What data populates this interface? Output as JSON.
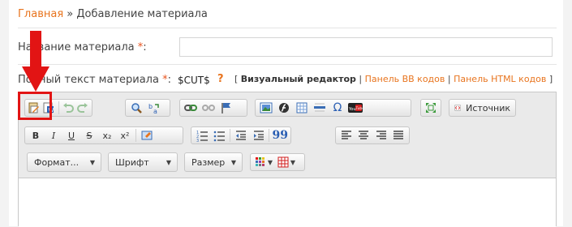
{
  "breadcrumb": {
    "home": "Главная",
    "separator": " » ",
    "current": "Добавление материала"
  },
  "form": {
    "title_label": "Название материала",
    "required_mark": "*",
    "title_suffix": ":",
    "fulltext_label": "Полный текст материала",
    "fulltext_suffix": ":",
    "cut_tag": "$CUT$",
    "help_mark": "?"
  },
  "modes": {
    "open_bracket": "[",
    "visual": "Визуальный редактор",
    "divider": "|",
    "bb": "Панель BB кодов",
    "html": "Панель HTML кодов",
    "close_bracket": "]"
  },
  "toolbar": {
    "source_label": "Источник",
    "bold": "B",
    "italic": "I",
    "underline": "U",
    "strike": "S",
    "subscript": "x₂",
    "superscript": "x²",
    "quote": "99",
    "format_label": "Формат...",
    "font_label": "Шрифт",
    "size_label": "Размер"
  },
  "colors": {
    "accent": "#e8741e",
    "required": "#e8541e",
    "highlight": "#e21414"
  }
}
